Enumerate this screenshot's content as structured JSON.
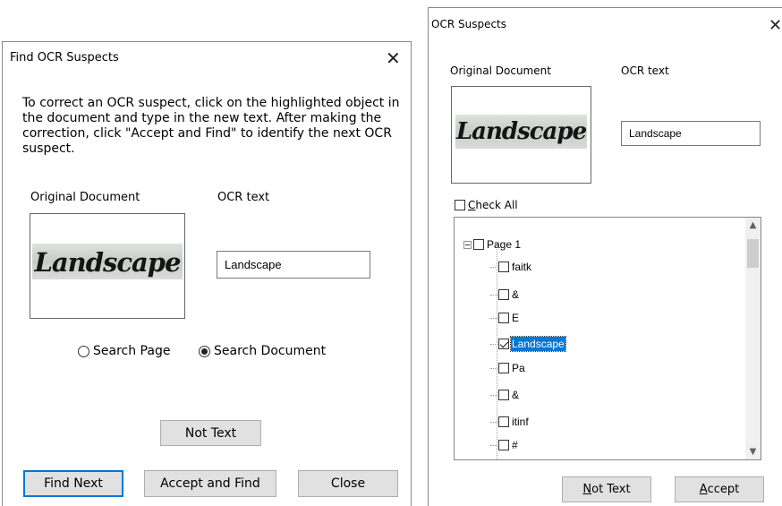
{
  "find_dialog": {
    "title": "Find OCR Suspects",
    "close_glyph": "✕",
    "instructions": "To correct an OCR suspect, click on the highlighted object in the document and type in the new text. After making the correction, click \"Accept and Find\" to identify the next OCR suspect.",
    "original_label": "Original Document",
    "ocr_label": "OCR text",
    "image_word": "Landscape",
    "ocr_value": "Landscape",
    "radio_search_page": "Search Page",
    "radio_search_document": "Search Document",
    "selected_scope": "Search Document",
    "not_text_button": "Not Text",
    "find_next_button": "Find Next",
    "accept_find_button": "Accept and Find",
    "close_button": "Close"
  },
  "suspects_dialog": {
    "title": "OCR Suspects",
    "close_glyph": "✕",
    "original_label": "Original Document",
    "ocr_label": "OCR text",
    "image_word": "Landscape",
    "ocr_value": "Landscape",
    "check_all_prefix": "C",
    "check_all_rest": "heck All",
    "tree": {
      "root": "Page 1",
      "items": [
        {
          "label": "faitk",
          "checked": false
        },
        {
          "label": "&",
          "checked": false
        },
        {
          "label": "E",
          "checked": false
        },
        {
          "label": "Landscape",
          "checked": true,
          "selected": true
        },
        {
          "label": "Pa",
          "checked": false
        },
        {
          "label": "&",
          "checked": false
        },
        {
          "label": "itinf",
          "checked": false
        },
        {
          "label": "#",
          "checked": false
        }
      ]
    },
    "not_text_prefix": "N",
    "not_text_rest": "ot Text",
    "accept_prefix": "A",
    "accept_rest": "ccept"
  },
  "colors": {
    "accent": "#0078d7",
    "button_bg": "#e1e1e1",
    "selection": "#0078d7"
  },
  "icons": {
    "close": "close-icon",
    "collapse": "collapse-icon",
    "scroll_up": "chevron-up-icon",
    "scroll_down": "chevron-down-icon"
  }
}
